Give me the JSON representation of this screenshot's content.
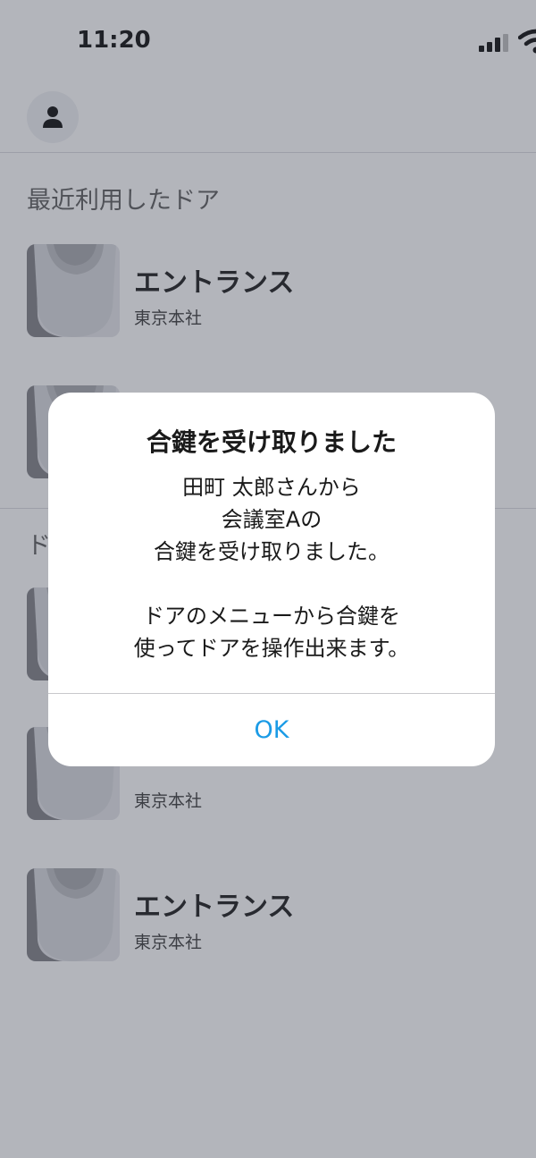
{
  "status_bar": {
    "time": "11:20"
  },
  "header": {
    "avatar_icon": "person-icon"
  },
  "recent_section": {
    "title": "最近利用したドア",
    "items": [
      {
        "name": "エントランス",
        "location": "東京本社"
      },
      {
        "name": "",
        "location": ""
      }
    ]
  },
  "doors_section": {
    "title": "ド",
    "items": [
      {
        "name": "",
        "location": ""
      },
      {
        "name": "",
        "location": "東京本社"
      },
      {
        "name": "エントランス",
        "location": "東京本社"
      }
    ]
  },
  "alert": {
    "title": "合鍵を受け取りました",
    "message_lines": [
      "田町 太郎さんから",
      "会議室Aの",
      "合鍵を受け取りました。",
      "",
      "ドアのメニューから合鍵を",
      "使ってドアを操作出来ます。"
    ],
    "ok_label": "OK",
    "accent_color": "#1a9be6"
  }
}
